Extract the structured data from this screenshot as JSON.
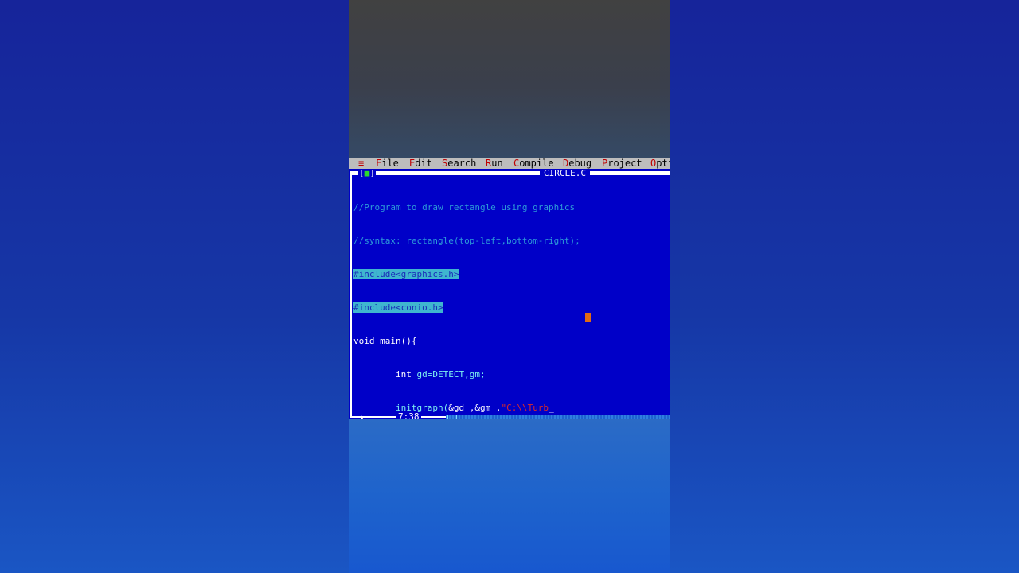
{
  "menu": {
    "system_icon": "≡",
    "items": [
      {
        "hot": "F",
        "rest": "ile"
      },
      {
        "hot": "E",
        "rest": "dit"
      },
      {
        "hot": "S",
        "rest": "earch"
      },
      {
        "hot": "R",
        "rest": "un"
      },
      {
        "hot": "C",
        "rest": "ompile"
      },
      {
        "hot": "D",
        "rest": "ebug"
      },
      {
        "hot": "P",
        "rest": "roject"
      },
      {
        "hot": "O",
        "rest": "pti"
      }
    ]
  },
  "window": {
    "close_bracket_left": "[",
    "close_symbol": "■",
    "close_bracket_right": "]",
    "title": "CIRCLE.C"
  },
  "code": {
    "line1": "//Program to draw rectangle using graphics",
    "line2": "//syntax: rectangle(top-left,bottom-right);",
    "line3": "#include<graphics.h>",
    "line4": "#include<conio.h>",
    "line5": "void main(){",
    "line6_indent": "        ",
    "line6_kw": "int ",
    "line6_rest": "gd=DETECT,gm;",
    "line7_indent": "        ",
    "line7_fn": "initgraph(",
    "line7_args": "&gd ,&gm ,",
    "line7_str": "\"C:\\\\Turb",
    "line7_cursor": "_"
  },
  "status": {
    "position": "7:38"
  },
  "colors": {
    "editor_bg": "#0000c8",
    "menu_bg": "#bdbdbd",
    "hotkey": "#c00000",
    "comment": "#2d9ad8",
    "string": "#d82a2a"
  }
}
